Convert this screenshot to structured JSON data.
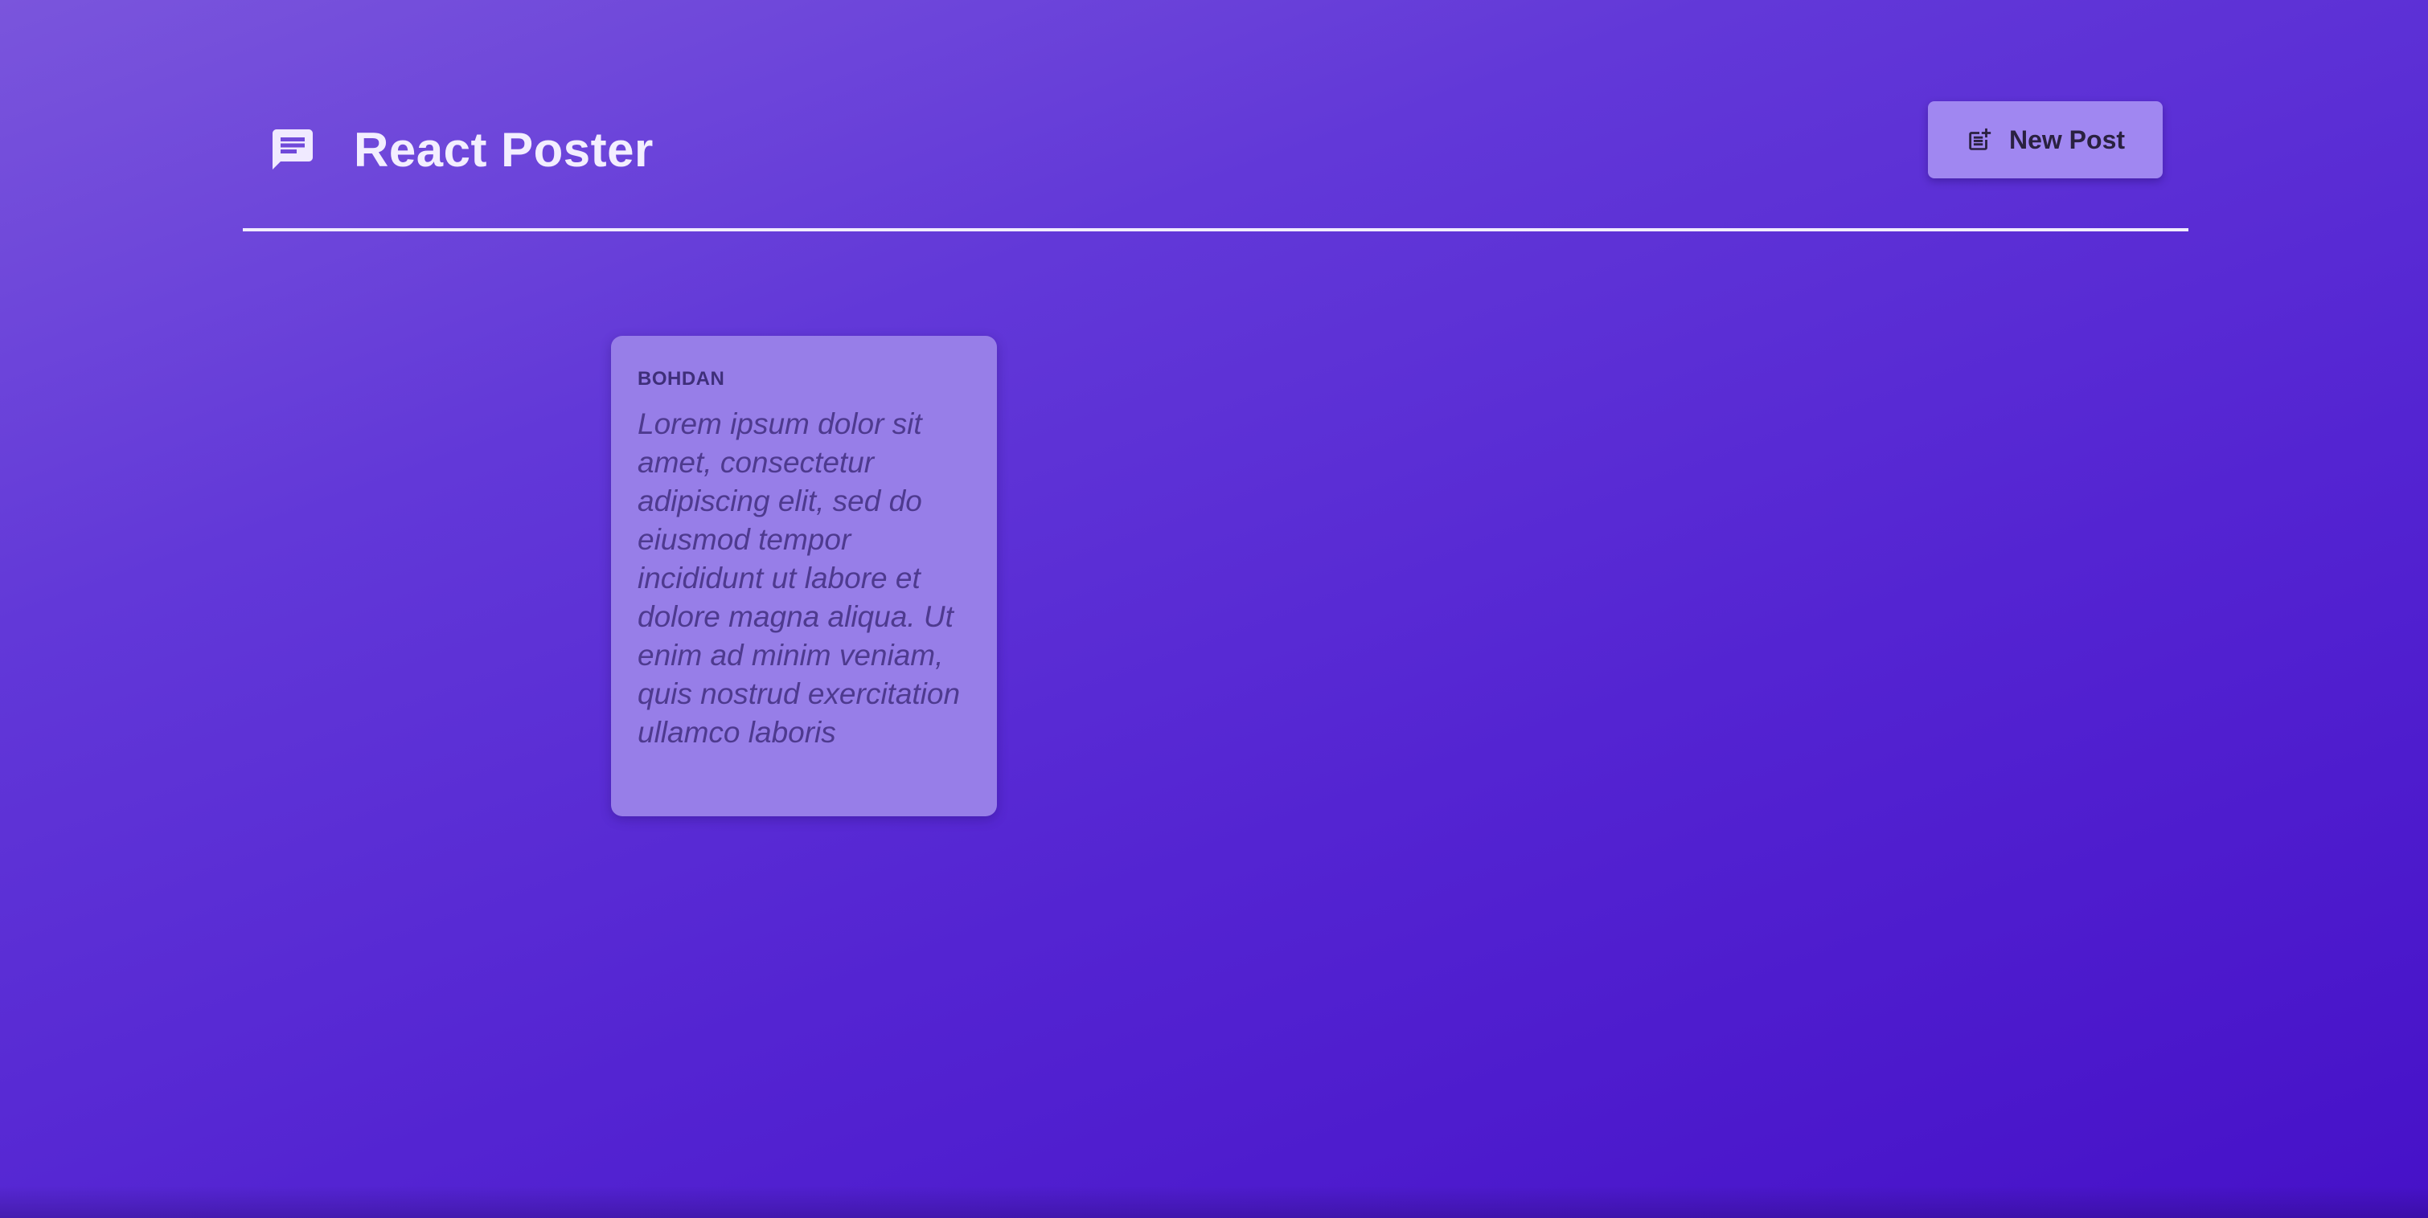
{
  "header": {
    "title": "React Poster",
    "logo_icon": "chat-message-icon",
    "new_post_button": {
      "label": "New Post",
      "icon": "post-add-icon"
    }
  },
  "posts": [
    {
      "author": "BOHDAN",
      "body": "Lorem ipsum dolor sit amet, consectetur adipiscing elit, sed do eiusmod tempor incididunt ut labore et dolore magna aliqua. Ut enim ad minim veniam, quis nostrud exercitation ullamco laboris"
    }
  ],
  "colors": {
    "background_start": "#7a55dc",
    "background_end": "#4611c8",
    "header_divider": "#f1ecff",
    "button_background": "#a087f1",
    "card_background": "#977ee8",
    "card_text": "#4e3a8f"
  }
}
